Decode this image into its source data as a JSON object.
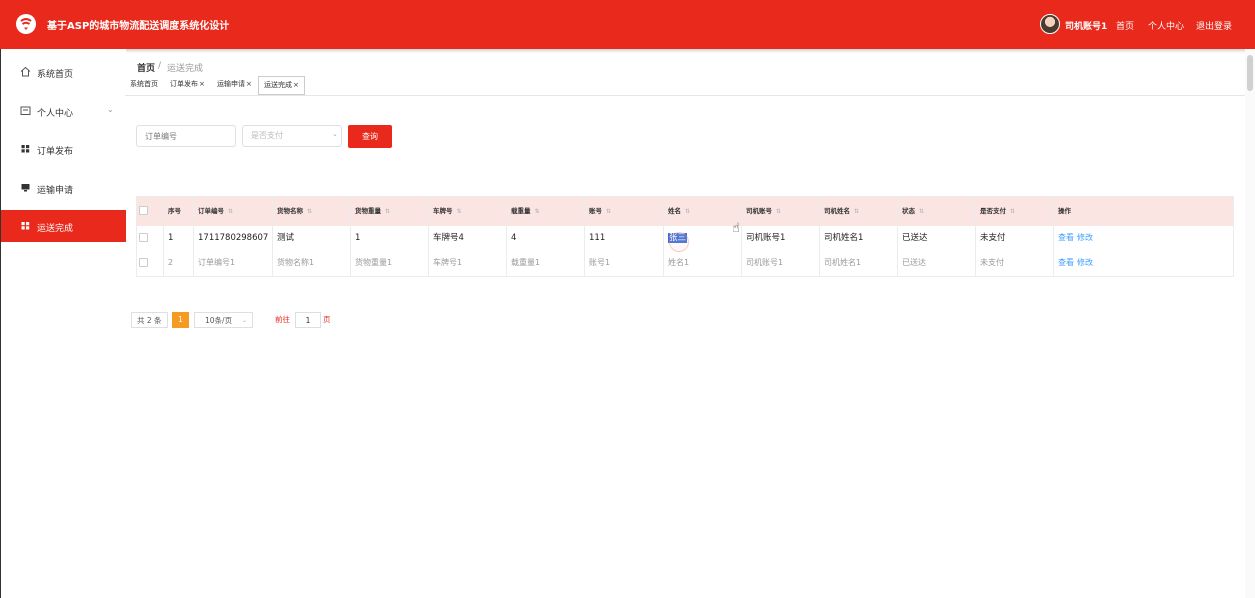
{
  "header": {
    "app_title": "基于ASP的城市物流配送调度系统化设计",
    "user_name": "司机账号1",
    "nav_home": "首页",
    "nav_profile": "个人中心",
    "nav_logout": "退出登录",
    "bg_color": "#e8291b"
  },
  "sidebar": {
    "items": [
      {
        "label": "系统首页",
        "icon": "home-icon"
      },
      {
        "label": "个人中心",
        "icon": "user-card-icon"
      },
      {
        "label": "订单发布",
        "icon": "grid-icon"
      },
      {
        "label": "运输申请",
        "icon": "monitor-icon"
      },
      {
        "label": "运送完成",
        "icon": "grid-icon",
        "active": true
      }
    ]
  },
  "breadcrumb": {
    "home": "首页",
    "separator": "/",
    "current": "运送完成"
  },
  "tabs": [
    {
      "label": "系统首页",
      "closable": false
    },
    {
      "label": "订单发布",
      "closable": true
    },
    {
      "label": "运输申请",
      "closable": true
    },
    {
      "label": "运送完成",
      "closable": true,
      "active": true
    }
  ],
  "tab_close": "×",
  "search": {
    "order_placeholder": "订单编号",
    "paid_placeholder": "是否支付",
    "query_label": "查询"
  },
  "table": {
    "headers": [
      "序号",
      "订单编号",
      "货物名称",
      "货物重量",
      "车牌号",
      "载重量",
      "账号",
      "姓名",
      "司机账号",
      "司机姓名",
      "状态",
      "是否支付",
      "操作"
    ],
    "rows": [
      [
        "1",
        "1711780298607",
        "测试",
        "1",
        "车牌号4",
        "4",
        "111",
        "张三",
        "司机账号1",
        "司机姓名1",
        "已送达",
        "未支付"
      ],
      [
        "2",
        "订单编号1",
        "货物名称1",
        "货物重量1",
        "车牌号1",
        "载重量1",
        "账号1",
        "姓名1",
        "司机账号1",
        "司机姓名1",
        "已送达",
        "未支付"
      ]
    ],
    "action_view": "查看",
    "action_edit": "修改"
  },
  "pagination": {
    "total": "共 2 条",
    "current_page": "1",
    "page_size": "10条/页",
    "goto_label": "前往",
    "goto_value": "1",
    "page_suffix": "页"
  }
}
